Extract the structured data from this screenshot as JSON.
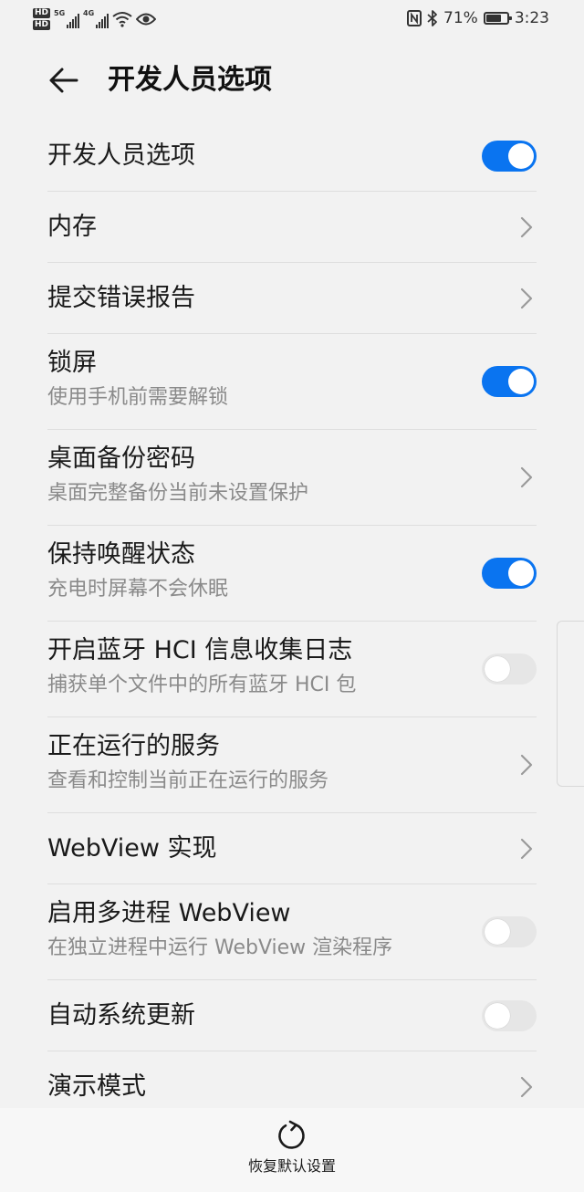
{
  "status_bar": {
    "hd1": "HD",
    "hd2": "HD",
    "net1": "5G",
    "net2": "4G",
    "battery_text": "71%",
    "battery_level": 0.71,
    "time": "3:23",
    "icons": [
      "signal-icon",
      "wifi-icon",
      "eye-icon",
      "nfc-icon",
      "bluetooth-icon",
      "battery-icon"
    ]
  },
  "header": {
    "title": "开发人员选项"
  },
  "settings": [
    {
      "label": "开发人员选项",
      "control": "toggle",
      "on": true
    },
    {
      "label": "内存",
      "control": "chevron"
    },
    {
      "label": "提交错误报告",
      "control": "chevron"
    },
    {
      "label": "锁屏",
      "subtitle": "使用手机前需要解锁",
      "control": "toggle",
      "on": true
    },
    {
      "label": "桌面备份密码",
      "subtitle": "桌面完整备份当前未设置保护",
      "control": "chevron"
    },
    {
      "label": "保持唤醒状态",
      "subtitle": "充电时屏幕不会休眠",
      "control": "toggle",
      "on": true
    },
    {
      "label": "开启蓝牙 HCI 信息收集日志",
      "subtitle": "捕获单个文件中的所有蓝牙 HCI 包",
      "control": "toggle",
      "on": false
    },
    {
      "label": "正在运行的服务",
      "subtitle": "查看和控制当前正在运行的服务",
      "control": "chevron"
    },
    {
      "label": "WebView 实现",
      "control": "chevron"
    },
    {
      "label": "启用多进程 WebView",
      "subtitle": "在独立进程中运行 WebView 渲染程序",
      "control": "toggle",
      "on": false
    },
    {
      "label": "自动系统更新",
      "control": "toggle",
      "on": false
    },
    {
      "label": "演示模式",
      "control": "chevron"
    }
  ],
  "bottom_bar": {
    "reset_label": "恢复默认设置",
    "icon": "refresh-icon"
  },
  "colors": {
    "accent": "#0a74f0",
    "background": "#f2f2f2",
    "secondary_text": "#8a8a8a"
  }
}
